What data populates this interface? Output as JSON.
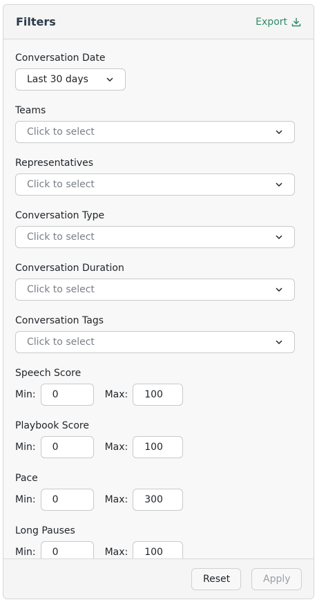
{
  "header": {
    "title": "Filters",
    "export_label": "Export"
  },
  "fields": {
    "date": {
      "label": "Conversation Date",
      "value": "Last 30 days"
    },
    "teams": {
      "label": "Teams",
      "placeholder": "Click to select"
    },
    "reps": {
      "label": "Representatives",
      "placeholder": "Click to select"
    },
    "type": {
      "label": "Conversation Type",
      "placeholder": "Click to select"
    },
    "duration": {
      "label": "Conversation Duration",
      "placeholder": "Click to select"
    },
    "tags": {
      "label": "Conversation Tags",
      "placeholder": "Click to select"
    },
    "speech": {
      "label": "Speech Score",
      "min_label": "Min:",
      "max_label": "Max:",
      "min": "0",
      "max": "100"
    },
    "playbook": {
      "label": "Playbook Score",
      "min_label": "Min:",
      "max_label": "Max:",
      "min": "0",
      "max": "100"
    },
    "pace": {
      "label": "Pace",
      "min_label": "Min:",
      "max_label": "Max:",
      "min": "0",
      "max": "300"
    },
    "pauses": {
      "label": "Long Pauses",
      "min_label": "Min:",
      "max_label": "Max:",
      "min": "0",
      "max": "100"
    }
  },
  "footer": {
    "reset_label": "Reset",
    "apply_label": "Apply"
  },
  "colors": {
    "accent": "#2e8b68",
    "border": "#c9c9c9",
    "placeholder": "#7a7f85"
  }
}
